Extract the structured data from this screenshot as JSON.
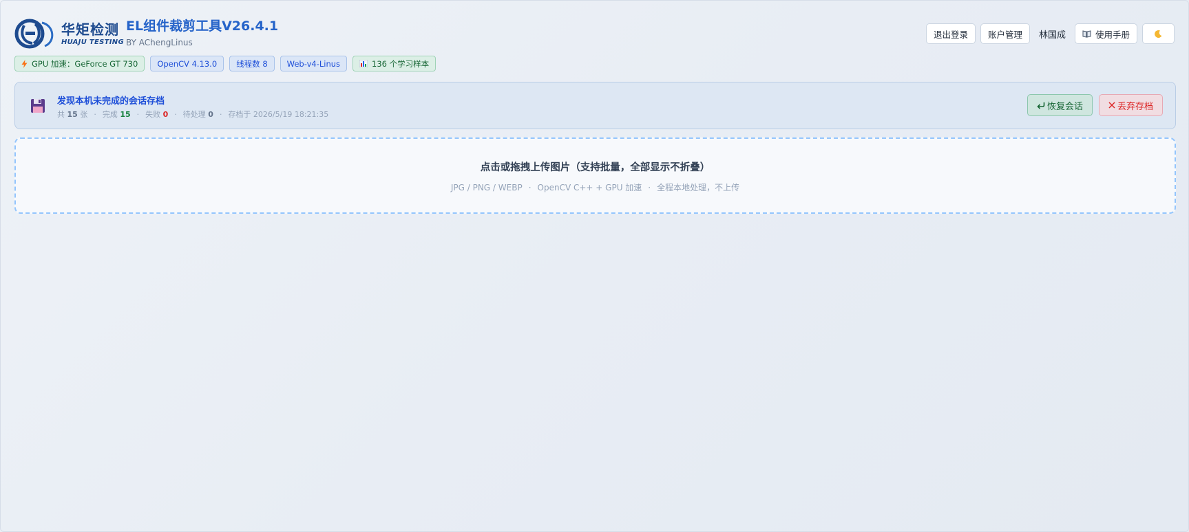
{
  "brand": {
    "logo_cn": "华矩检测",
    "logo_en": "HUAJU TESTING",
    "app_title": "EL组件裁剪工具V26.4.1",
    "app_subtitle": "BY AChengLinus"
  },
  "header": {
    "logout_label": "退出登录",
    "account_label": "账户管理",
    "user_name": "林国成",
    "manual_label": "使用手册",
    "manual_icon": "book-icon",
    "theme_icon": "moon-icon"
  },
  "tags": {
    "gpu": "GPU 加速：GeForce GT 730",
    "gpu_icon": "lightning-icon",
    "opencv": "OpenCV 4.13.0",
    "threads": "线程数 8",
    "web": "Web-v4-Linus",
    "samples": "136 个学习样本",
    "samples_icon": "bar-chart-icon"
  },
  "session": {
    "title": "发现本机未完成的会话存档",
    "total_prefix": "共",
    "total": "15",
    "total_suffix": "张",
    "done_label": "完成",
    "done": "15",
    "failed_label": "失败",
    "failed": "0",
    "pending_label": "待处理",
    "pending": "0",
    "saved_at": "存档于 2026/5/19 18:21:35",
    "restore_label": "恢复会话",
    "discard_label": "丢弃存档"
  },
  "upload": {
    "title": "点击或拖拽上传图片（支持批量，全部显示不折叠）",
    "formats": "JPG / PNG / WEBP",
    "engine": "OpenCV C++ + GPU 加速",
    "privacy": "全程本地处理，不上传"
  },
  "colors": {
    "accent": "#2563c9",
    "success": "#15803d",
    "danger": "#dc2626"
  }
}
